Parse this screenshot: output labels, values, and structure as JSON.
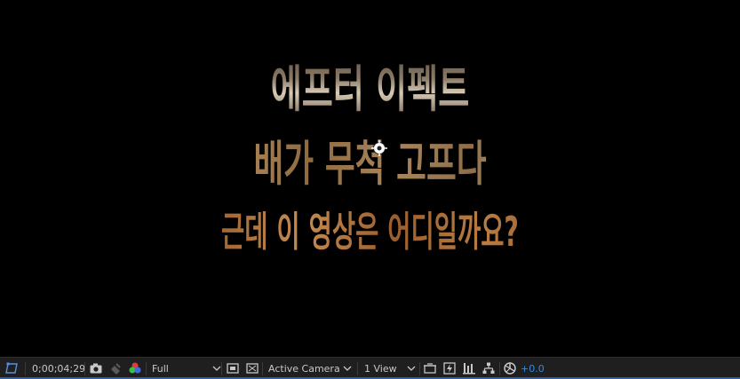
{
  "composition": {
    "title_lines": [
      "에프터 이펙트",
      "배가 무척 고프다",
      "근데 이 영상은 어디일까요?"
    ]
  },
  "toolbar": {
    "timecode": "0;00;04;29",
    "resolution": "Full",
    "view_camera": "Active Camera",
    "view_layout": "1 View",
    "exposure_value": "+0.0",
    "accent_color": "#2c5fa8",
    "exposure_color": "#2d8ceb",
    "icons": [
      "region-of-interest-icon",
      "snapshot-camera-icon",
      "show-snapshot-icon",
      "color-channels-icon",
      "toggle-transparency-grid-icon",
      "toggle-mask-visibility-icon",
      "3d-draft-icon",
      "fast-previews-icon",
      "timeline-icon",
      "flowchart-icon",
      "reset-exposure-icon"
    ]
  }
}
